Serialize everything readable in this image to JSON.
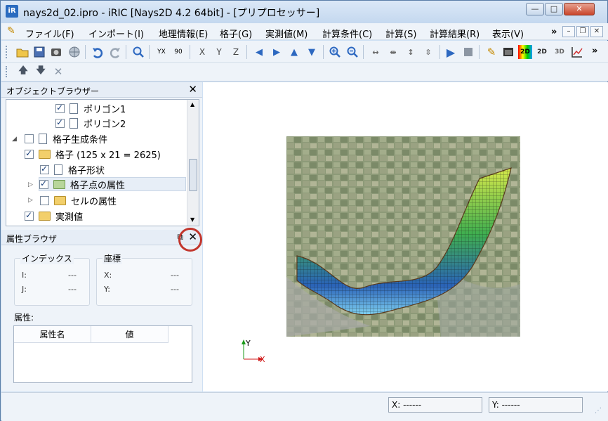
{
  "window": {
    "app_icon": "iR",
    "title": "nays2d_02.ipro - iRIC [Nays2D 4.2 64bit] - [プリプロセッサー]",
    "minimize": "—",
    "maximize": "□",
    "close": "✕"
  },
  "menu": {
    "items": [
      "ファイル(F)",
      "インポート(I)",
      "地理情報(E)",
      "格子(G)",
      "実測値(M)",
      "計算条件(C)",
      "計算(S)",
      "計算結果(R)",
      "表示(V)"
    ],
    "overflow": "»",
    "mdi_min": "–",
    "mdi_restore": "❐",
    "mdi_close": "✕"
  },
  "toolbar": {
    "overflow": "»",
    "icons": [
      "open-folder-icon",
      "save-icon",
      "snapshot-icon",
      "globe-icon",
      "undo-icon",
      "redo-icon",
      "zoom-fit-icon",
      "axis-xy-icon",
      "axis-rotate-icon",
      "view-x-icon",
      "view-y-icon",
      "view-z-icon",
      "pan-left-icon",
      "pan-right-icon",
      "pan-up-icon",
      "pan-down-icon",
      "zoom-in-icon",
      "zoom-out-icon",
      "expand-h-icon",
      "shrink-h-icon",
      "expand-v-icon",
      "shrink-v-icon",
      "run-icon",
      "stop-icon",
      "edit-icon",
      "window-icon",
      "2d-color-icon",
      "2d-icon",
      "3d-icon",
      "graph-icon"
    ],
    "labels": {
      "axis_xy": "YX",
      "axis_rot": "90",
      "view_x": "X",
      "view_y": "Y",
      "view_z": "Z",
      "d2a": "2D",
      "d2b": "2D",
      "d3": "3D"
    }
  },
  "toolbar2": {
    "icons": [
      "move-up-icon",
      "move-down-icon",
      "delete-icon"
    ]
  },
  "object_browser": {
    "title": "オブジェクトブラウザー",
    "close": "✕",
    "items": [
      {
        "label": "ポリゴン1",
        "checked": true
      },
      {
        "label": "ポリゴン2",
        "checked": true
      },
      {
        "label": "格子生成条件",
        "checked": false
      },
      {
        "label": "格子 (125 x 21 = 2625)",
        "checked": true
      },
      {
        "label": "格子形状",
        "checked": true
      },
      {
        "label": "格子点の属性",
        "checked": true
      },
      {
        "label": "セルの属性",
        "checked": false
      },
      {
        "label": "実測値",
        "checked": true
      }
    ],
    "scroll_up": "▲",
    "scroll_down": "▼"
  },
  "property_browser": {
    "title": "属性ブラウザ",
    "close": "✕",
    "float": "⧉",
    "index_group": "インデックス",
    "coord_group": "座標",
    "i_label": "I:",
    "j_label": "J:",
    "i_value": "---",
    "j_value": "---",
    "x_label": "X:",
    "y_label": "Y:",
    "x_value": "---",
    "y_value": "---",
    "attr_label": "属性:",
    "col_name": "属性名",
    "col_value": "値"
  },
  "viewport": {
    "axis_y": "Y",
    "axis_x": "X",
    "axis_y_color": "#1a9a1a",
    "axis_x_color": "#d01818"
  },
  "status": {
    "x": "X: ------",
    "y": "Y: ------"
  },
  "colors": {
    "annotation": "#c2362d",
    "window_frame": "#cfe0f3"
  }
}
